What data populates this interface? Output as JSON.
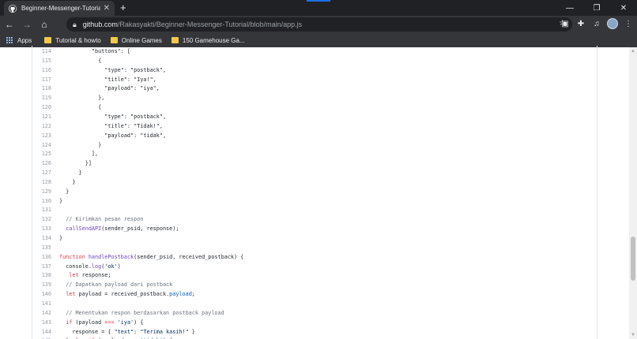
{
  "tab": {
    "title": "Beginner-Messenger-Tutorial/ap",
    "close": "✕",
    "new_tab": "+"
  },
  "window": {
    "minimize": "—",
    "maximize": "❐",
    "close": "✕"
  },
  "toolbar": {
    "back": "←",
    "forward": "→",
    "home": "⌂",
    "url_host": "github.com",
    "url_path": "/Rakasyakti/Beginner-Messenger-Tutorial/blob/main/app.js",
    "star": "☆"
  },
  "bookmarks": [
    {
      "label": "Apps",
      "icon": "apps-grid-icon"
    },
    {
      "label": "Tutorial & howto",
      "icon": "folder-icon"
    },
    {
      "label": "Online Games",
      "icon": "folder-icon"
    },
    {
      "label": "150 Gamehouse Ga...",
      "icon": "folder-icon"
    }
  ],
  "code": [
    {
      "n": "114",
      "tokens": [
        [
          "",
          "          \"buttons\": ["
        ]
      ]
    },
    {
      "n": "115",
      "tokens": [
        [
          "",
          "            {"
        ]
      ]
    },
    {
      "n": "116",
      "tokens": [
        [
          "",
          "              \"type\": \"postback\","
        ]
      ]
    },
    {
      "n": "117",
      "tokens": [
        [
          "",
          "              \"title\": \"Iya!\","
        ]
      ]
    },
    {
      "n": "118",
      "tokens": [
        [
          "",
          "              \"payload\": \"iya\","
        ]
      ]
    },
    {
      "n": "119",
      "tokens": [
        [
          "",
          "            },"
        ]
      ]
    },
    {
      "n": "120",
      "tokens": [
        [
          "",
          "            {"
        ]
      ]
    },
    {
      "n": "121",
      "tokens": [
        [
          "",
          "              \"type\": \"postback\","
        ]
      ]
    },
    {
      "n": "122",
      "tokens": [
        [
          "",
          "              \"title\": \"Tidak!\","
        ]
      ]
    },
    {
      "n": "123",
      "tokens": [
        [
          "",
          "              \"payload\": \"tidak\","
        ]
      ]
    },
    {
      "n": "124",
      "tokens": [
        [
          "",
          "            }"
        ]
      ]
    },
    {
      "n": "125",
      "tokens": [
        [
          "",
          "          ],"
        ]
      ]
    },
    {
      "n": "126",
      "tokens": [
        [
          "",
          "        }]"
        ]
      ]
    },
    {
      "n": "127",
      "tokens": [
        [
          "",
          "      }"
        ]
      ]
    },
    {
      "n": "128",
      "tokens": [
        [
          "",
          "    }"
        ]
      ]
    },
    {
      "n": "129",
      "tokens": [
        [
          "",
          "  }"
        ]
      ]
    },
    {
      "n": "130",
      "tokens": [
        [
          "",
          "}"
        ]
      ]
    },
    {
      "n": "131",
      "tokens": [
        [
          "",
          ""
        ]
      ]
    },
    {
      "n": "132",
      "tokens": [
        [
          "",
          "  "
        ],
        [
          "cmt",
          "// Kirimkan pesan respon"
        ]
      ]
    },
    {
      "n": "133",
      "tokens": [
        [
          "",
          "  "
        ],
        [
          "fn",
          "callSendAPI"
        ],
        [
          "",
          "(sender_psid, response);"
        ]
      ]
    },
    {
      "n": "134",
      "tokens": [
        [
          "",
          "}"
        ]
      ]
    },
    {
      "n": "135",
      "tokens": [
        [
          "",
          ""
        ]
      ]
    },
    {
      "n": "136",
      "tokens": [
        [
          "kw",
          "function"
        ],
        [
          "",
          " "
        ],
        [
          "fn",
          "handlePostback"
        ],
        [
          "",
          "(sender_psid, received_postback) {"
        ]
      ]
    },
    {
      "n": "137",
      "tokens": [
        [
          "",
          "  console."
        ],
        [
          "fn",
          "log"
        ],
        [
          "",
          "("
        ],
        [
          "str",
          "'ok'"
        ],
        [
          "",
          ")"
        ]
      ]
    },
    {
      "n": "138",
      "tokens": [
        [
          "",
          "   "
        ],
        [
          "kw",
          "let"
        ],
        [
          "",
          " response;"
        ]
      ]
    },
    {
      "n": "139",
      "tokens": [
        [
          "",
          "  "
        ],
        [
          "cmt",
          "// Dapatkan payload dari postback"
        ]
      ]
    },
    {
      "n": "140",
      "tokens": [
        [
          "",
          "  "
        ],
        [
          "kw",
          "let"
        ],
        [
          "",
          " payload = received_postback."
        ],
        [
          "prop",
          "payload"
        ],
        [
          "",
          ";"
        ]
      ]
    },
    {
      "n": "141",
      "tokens": [
        [
          "",
          ""
        ]
      ]
    },
    {
      "n": "142",
      "tokens": [
        [
          "",
          "  "
        ],
        [
          "cmt",
          "// Menentukan respon berdasarkan postback payload"
        ]
      ]
    },
    {
      "n": "143",
      "tokens": [
        [
          "",
          "  "
        ],
        [
          "kw",
          "if"
        ],
        [
          "",
          " (payload "
        ],
        [
          "kw",
          "==="
        ],
        [
          "",
          " "
        ],
        [
          "str",
          "'iya'"
        ],
        [
          "",
          ") {"
        ]
      ]
    },
    {
      "n": "144",
      "tokens": [
        [
          "",
          "    response = { "
        ],
        [
          "str",
          "\"text\""
        ],
        [
          "",
          ": "
        ],
        [
          "str",
          "\"Terima kasih!\""
        ],
        [
          "",
          " }"
        ]
      ]
    },
    {
      "n": "145",
      "tokens": [
        [
          "",
          "  } "
        ],
        [
          "kw",
          "else if"
        ],
        [
          "",
          " (payload "
        ],
        [
          "kw",
          "==="
        ],
        [
          "",
          " "
        ],
        [
          "str",
          "'tidak'"
        ],
        [
          "",
          ") {"
        ]
      ]
    }
  ],
  "colors": {
    "tabstrip": "#202124",
    "toolbar": "#35363a",
    "code_comment": "#6a737d",
    "code_keyword": "#d73a49",
    "code_string": "#032f62",
    "code_function": "#6f42c1"
  }
}
